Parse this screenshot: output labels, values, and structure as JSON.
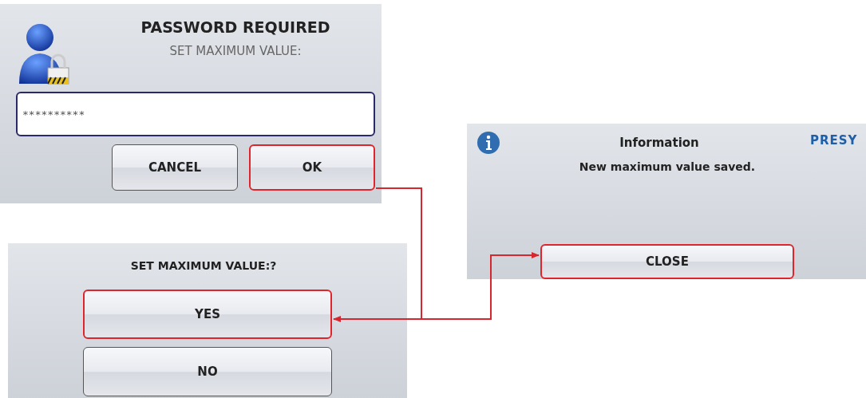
{
  "dialogs": [
    {
      "kind": "password",
      "title": "PASSWORD REQUIRED",
      "prompt": "SET MAXIMUM VALUE:",
      "field": {
        "value": "**********"
      },
      "buttons": [
        {
          "label": "CANCEL",
          "highlighted": false
        },
        {
          "label": "OK",
          "highlighted": true
        }
      ]
    },
    {
      "kind": "info",
      "title": "Information",
      "message": "New maximum value saved.",
      "logo": "PRESY",
      "buttons": [
        {
          "label": "CLOSE",
          "highlighted": true
        }
      ]
    },
    {
      "kind": "confirm",
      "title": "SET MAXIMUM VALUE:?",
      "buttons": [
        {
          "label": "YES",
          "highlighted": true
        },
        {
          "label": "NO",
          "highlighted": false
        }
      ]
    }
  ]
}
